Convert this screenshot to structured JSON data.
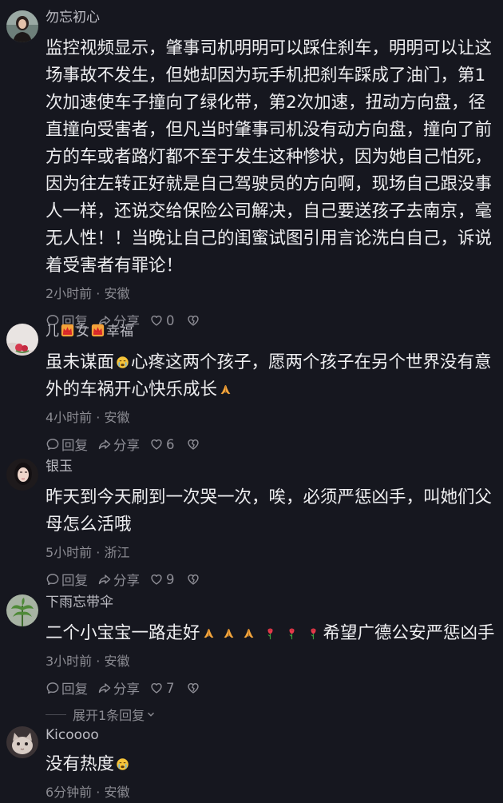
{
  "comments": [
    {
      "username": "勿忘初心",
      "content": "监控视频显示，肇事司机明明可以踩住刹车，明明可以让这场事故不发生，但她却因为玩手机把刹车踩成了油门，第1次加速使车子撞向了绿化带，第2次加速，扭动方向盘，径直撞向受害者，但凡当时肇事司机没有动方向盘，撞向了前方的车或者路灯都不至于发生这种惨状，因为她自己怕死，因为往左转正好就是自己驾驶员的方向啊，现场自己跟没事人一样，还说交给保险公司解决，自己要送孩子去南京，毫无人性！！当晚让自己的闺蜜试图引用言论洗白自己，诉说着受害者有罪论！",
      "time": "2小时前",
      "location": "安徽",
      "reply_label": "回复",
      "share_label": "分享",
      "like_count": "0"
    },
    {
      "username_parts": [
        "儿",
        "女",
        "幸福"
      ],
      "content_parts": [
        "虽未谋面",
        "心疼这两个孩子，愿两个孩子在另个世界没有意外的车祸开心快乐成长"
      ],
      "time": "4小时前",
      "location": "安徽",
      "reply_label": "回复",
      "share_label": "分享",
      "like_count": "6"
    },
    {
      "username": "银玉",
      "content": "昨天到今天刷到一次哭一次，唉，必须严惩凶手，叫她们父母怎么活哦",
      "time": "5小时前",
      "location": "浙江",
      "reply_label": "回复",
      "share_label": "分享",
      "like_count": "9"
    },
    {
      "username": "下雨忘带伞",
      "content_parts": [
        "二个小宝宝一路走好",
        "希望广德公安严惩凶手"
      ],
      "time": "3小时前",
      "location": "安徽",
      "reply_label": "回复",
      "share_label": "分享",
      "like_count": "7",
      "expand_label": "展开1条回复"
    },
    {
      "username": "Kicoooo",
      "content": "没有热度",
      "time": "6分钟前",
      "location": "安徽"
    }
  ],
  "meta_separator": "·",
  "icons": [
    "reply-icon",
    "share-icon",
    "heart-icon",
    "dislike-heart-icon",
    "chevron-down-icon",
    "crying-emoji",
    "praying-hands-emoji",
    "rose-emoji",
    "crown-emoji"
  ],
  "colors": {
    "background": "#16171f",
    "text": "#eeeef0",
    "secondary": "#8b8b92"
  }
}
